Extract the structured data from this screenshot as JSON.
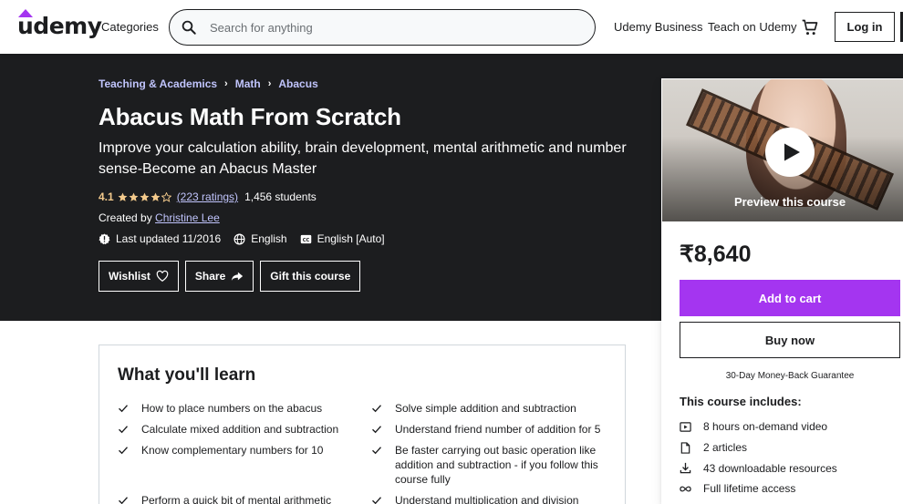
{
  "header": {
    "logo_text": "udemy",
    "categories_label": "Categories",
    "search_placeholder": "Search for anything",
    "business_label": "Udemy Business",
    "teach_label": "Teach on Udemy",
    "login_label": "Log in",
    "colors": {
      "brand_accent": "#a435f0",
      "text": "#1c1d1f"
    }
  },
  "course": {
    "breadcrumb": [
      "Teaching & Academics",
      "Math",
      "Abacus"
    ],
    "title": "Abacus Math From Scratch",
    "subtitle": "Improve your calculation ability, brain development, mental arithmetic and number sense-Become an Abacus Master",
    "rating": "4.1",
    "ratings_count": "(223 ratings)",
    "students": "1,456 students",
    "created_by_label": "Created by",
    "instructor": "Christine Lee",
    "last_updated": "Last updated 11/2016",
    "language": "English",
    "captions": "English [Auto]",
    "actions": {
      "wishlist": "Wishlist",
      "share": "Share",
      "gift": "Gift this course"
    }
  },
  "sidebar": {
    "preview_label": "Preview this course",
    "price": "₹8,640",
    "add_to_cart": "Add to cart",
    "buy_now": "Buy now",
    "guarantee": "30-Day Money-Back Guarantee",
    "includes_title": "This course includes:",
    "includes": [
      {
        "icon": "video-icon",
        "label": "8 hours on-demand video"
      },
      {
        "icon": "article-icon",
        "label": "2 articles"
      },
      {
        "icon": "download-icon",
        "label": "43 downloadable resources"
      },
      {
        "icon": "infinity-icon",
        "label": "Full lifetime access"
      }
    ]
  },
  "learn": {
    "heading": "What you'll learn",
    "items": [
      "How to place numbers on the abacus",
      "Solve simple addition and subtraction",
      "Calculate mixed addition and subtraction",
      "Understand friend number of addition for 5",
      "Know complementary numbers for 10",
      "Be faster carrying out basic operation like addition and subtraction - if you follow this course fully",
      "Perform a quick bit of mental arithmetic",
      "Understand multiplication and division"
    ]
  }
}
